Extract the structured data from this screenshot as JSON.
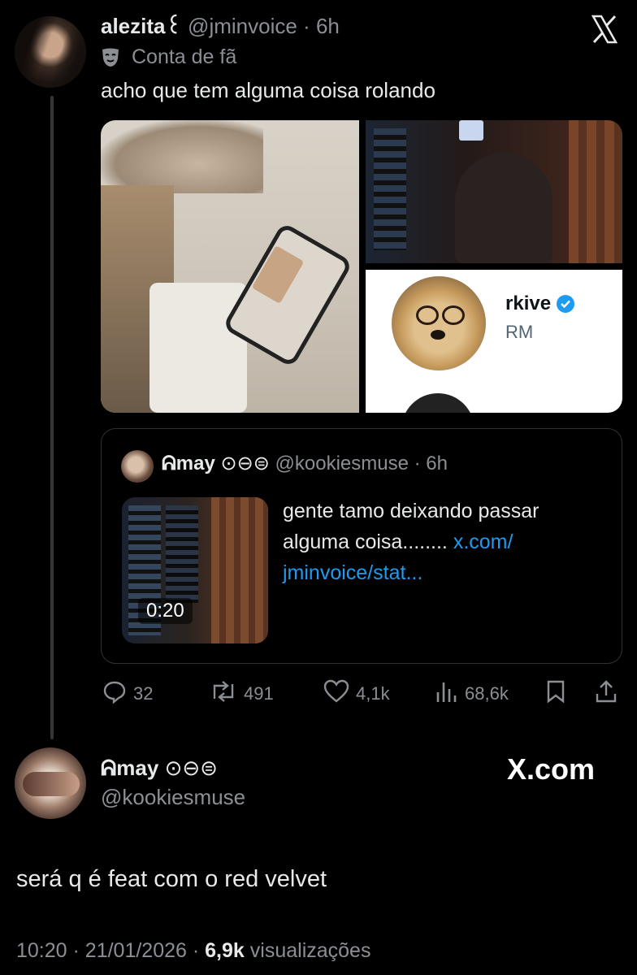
{
  "tweet": {
    "display_name": "alezita꒰",
    "handle": "@jminvoice",
    "separator": "·",
    "time": "6h",
    "account_label": "Conta de fã",
    "text": "acho que tem alguma coisa rolando"
  },
  "media_card": {
    "name": "rkive",
    "handle": "RM"
  },
  "quote": {
    "display_name": "ᕱmay",
    "symbols": "⊙⊖⊜",
    "handle": "@kookiesmuse",
    "separator": "·",
    "time": "6h",
    "text": "gente tamo deixando passar alguma coisa........",
    "link": "x.com/jminvoice/stat...",
    "link_line1": "x.com/",
    "link_line2": "jminvoice/stat...",
    "video_duration": "0:20"
  },
  "actions": {
    "replies": "32",
    "reposts": "491",
    "likes": "4,1k",
    "views": "68,6k"
  },
  "reply": {
    "display_name": "ᕱmay",
    "symbols": "⊙⊖⊜",
    "handle": "@kookiesmuse",
    "brand": "X.com",
    "text": "será q é feat com o red velvet",
    "time": "10:20",
    "date": "21/01/2026",
    "separator": "·",
    "views_count": "6,9k",
    "views_label": "visualizações"
  },
  "colors": {
    "background": "#000000",
    "text": "#e7e9ea",
    "secondary": "#8b8f94",
    "link": "#1d9bf0",
    "verified": "#1d9bf0"
  },
  "icons": [
    "x-logo-icon",
    "theater-mask-icon",
    "reply-icon",
    "repost-icon",
    "like-icon",
    "views-icon",
    "bookmark-icon",
    "share-icon",
    "verified-badge-icon"
  ]
}
